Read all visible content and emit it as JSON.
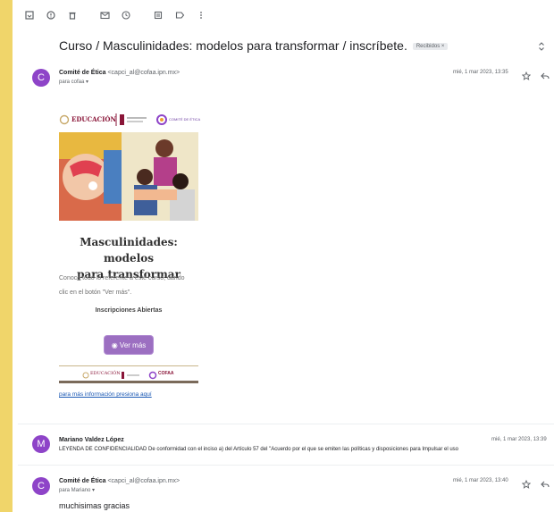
{
  "toolbar": {
    "buttons": [
      "archive-icon",
      "report-icon",
      "delete-icon",
      "mark-unread-icon",
      "snooze-icon",
      "tasks-icon",
      "label-icon",
      "more-icon"
    ]
  },
  "subject": "Curso / Masculinidades: modelos para transformar / inscríbete.",
  "subject_badge": "Recibidos ×",
  "msg1": {
    "avatar": "C",
    "sender_name": "Comité de Ética",
    "sender_email": "<capci_al@cofaa.ipn.mx>",
    "to": "para cofaa ▾",
    "date": "mié, 1 mar 2023, 13:35"
  },
  "flyer": {
    "logo_educacion": "EDUCACIÓN",
    "logo_comite": "COMITÉ DE ÉTICA",
    "title_line1": "Masculinidades: modelos",
    "title_line2": "para transformar",
    "text_line1": "Conoce todo lo referente a este curso, dando",
    "text_line2": "clic en el botón \"Ver más\".",
    "inscripciones": "Inscripciones Abiertas",
    "button": "◉ Ver más",
    "footer_educacion": "EDUCACIÓN",
    "footer_cofaa": "COFAA"
  },
  "link": "para más información presiona aquí",
  "msg2": {
    "avatar": "M",
    "sender_name": "Mariano Valdez López",
    "date": "mié, 1 mar 2023, 13:39",
    "snippet": "LEYENDA DE CONFIDENCIALIDAD De conformidad con el inciso a) del Artículo 57 del \"Acuerdo por el que se emiten las políticas y disposiciones para Impulsar el uso"
  },
  "msg3": {
    "avatar": "C",
    "sender_name": "Comité de Ética",
    "sender_email": "<capci_al@cofaa.ipn.mx>",
    "to": "para Mariano ▾",
    "date": "mié, 1 mar 2023, 13:40",
    "body": "muchisimas gracias"
  },
  "colors": {
    "side_bar": "#f0d56a",
    "avatar": "#8e44c8",
    "button": "#9c6fc1",
    "link": "#1a58b4"
  }
}
